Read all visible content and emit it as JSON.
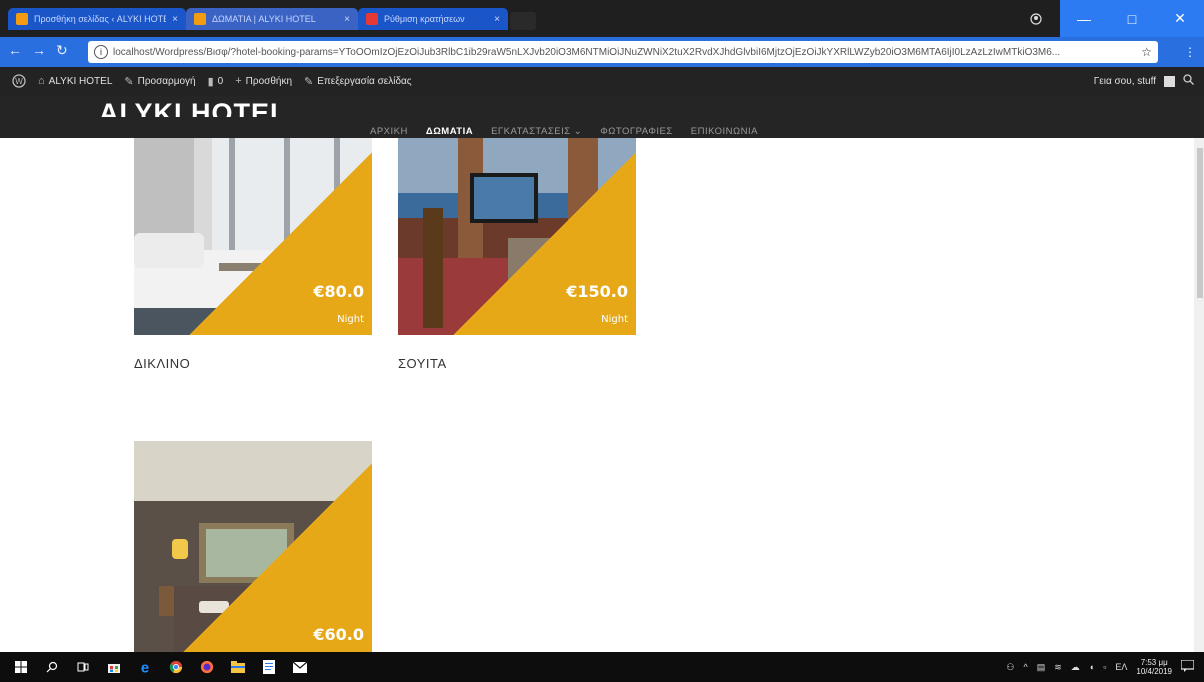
{
  "browser": {
    "tabs": [
      {
        "title": "Προσθήκη σελίδας ‹ ALYKI HOTEL — WordPress",
        "active": false,
        "close": "×"
      },
      {
        "title": "ΔΩΜΑΤΙΑ | ALYKI HOTEL",
        "active": true,
        "close": "×"
      },
      {
        "title": "Ρύθμιση κρατήσεων",
        "active": false,
        "close": "×"
      }
    ],
    "url": "localhost/Wordpress/Βισφ/?hotel-booking-params=YToOOmIzOjEzOiJub3RlbC1ib29raW5nLXJvb20iO3M6NTMiOiJNuZWNiX2tuX2RvdXJhdGlvbiI6MjtzOjEzOiJkYXRlLWZyb20iO3M6MTA6IjI0LzAzLzIwMTkiO3M6...",
    "window_buttons": {
      "minimize": "—",
      "maximize": "□",
      "close": "✕"
    }
  },
  "adminbar": {
    "wp_logo": "W",
    "site_name": "ALYKI HOTEL",
    "customize": "Προσαρμογή",
    "comments_count": "0",
    "new": "Προσθήκη",
    "edit_page": "Επεξεργασία σελίδας",
    "greeting": "Γεια σου, stuff"
  },
  "site": {
    "logo": "ALYKI HOTEL",
    "nav": [
      {
        "label": "ΑΡΧΙΚΗ",
        "active": false
      },
      {
        "label": "ΔΩΜΑΤΙΑ",
        "active": true
      },
      {
        "label": "ΕΓΚΑΤΑΣΤΑΣΕΙΣ",
        "active": false
      },
      {
        "label": "ΦΩΤΟΓΡΑΦΙΕΣ",
        "active": false
      },
      {
        "label": "ΕΠΙΚΟΙΝΩΝΙΑ",
        "active": false
      }
    ]
  },
  "rooms": [
    {
      "name": "ΔΙΚΛΙΝΟ",
      "price": "€80.0",
      "per": "Night"
    },
    {
      "name": "ΣΟΥΙΤΑ",
      "price": "€150.0",
      "per": "Night"
    },
    {
      "name": "",
      "price": "€60.0",
      "per": ""
    }
  ],
  "taskbar": {
    "time": "7:53 μμ",
    "date": "10/4/2019",
    "language": "ΕΛ"
  },
  "colors": {
    "accent": "#e6a816",
    "header_bg": "#252525",
    "browser_blue": "#2a6fe0"
  }
}
